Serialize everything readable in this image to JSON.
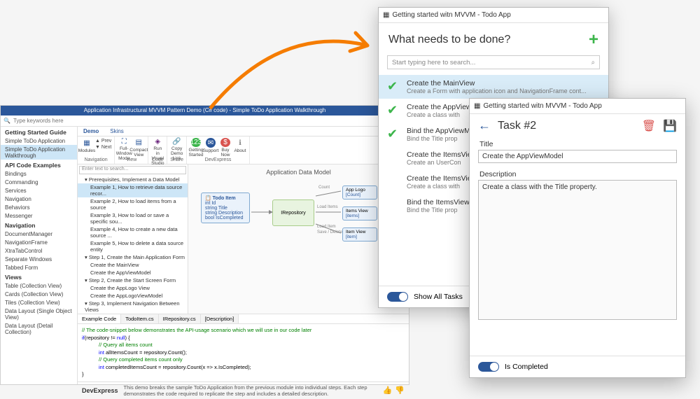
{
  "ide": {
    "title": "Application Infrastructural MVVM Pattern Demo (C# code) - Simple ToDo Application Walkthrough",
    "search_placeholder": "Type keywords here",
    "ribbon_tabs": {
      "demo": "Demo",
      "skins": "Skins"
    },
    "ribbon": {
      "modules": "Modules",
      "prev": "Prev",
      "next": "Next",
      "navigation": "Navigation",
      "fullwindow": "Full-Window Mode",
      "compact": "Compact View",
      "view": "View",
      "runvs": "Run in Visual Studio",
      "code": "Code",
      "copy": "Copy Demo Link",
      "share": "Share",
      "getting": "Getting Started",
      "support": "Support",
      "buy": "Buy Now",
      "about": "About",
      "dx": "DevExpress"
    },
    "sidebar": {
      "h1": "Getting Started Guide",
      "items1": [
        "Simple ToDo Application",
        "Simple ToDo Application Walkthrough"
      ],
      "h2": "API Code Examples",
      "items2": [
        "Bindings",
        "Commanding",
        "Services",
        "Navigation",
        "Behaviors",
        "Messenger"
      ],
      "h3": "Navigation",
      "items3": [
        "DocumentManager",
        "NavigationFrame",
        "XtraTabControl",
        "Separate Windows",
        "Tabbed Form"
      ],
      "h4": "Views",
      "items4": [
        "Table (Collection View)",
        "Cards (Collection View)",
        "Tiles (Collection View)",
        "Data Layout (Single Object View)",
        "Data Layout (Detail Collection)"
      ]
    },
    "tree": {
      "search": "Enter text to search...",
      "g1": "Prerequisites, Implement a Data Model",
      "e1": "Example 1, How to retrieve data source recor...",
      "e2": "Example 2, How to load items from a source",
      "e3": "Example 3, How to load or save a specific sou...",
      "e4": "Example 4, How to create a new data source ...",
      "e5": "Example 5, How to delete a data source entity",
      "g2": "Step 1, Create the Main Application Form",
      "s2a": "Create the MainView",
      "s2b": "Create the AppViewModel",
      "g3": "Step 2, Create the Start Screen Form",
      "s3a": "Create the AppLogo View",
      "s3b": "Create the AppLogoViewModel",
      "g4": "Step 3, Implement Navigation Between Views"
    },
    "diagram": {
      "title": "Application Data Model",
      "todo": "Todo Item",
      "todo_id": "int Id",
      "todo_title": "string Title",
      "todo_desc": "string Description",
      "todo_done": "bool IsCompleted",
      "repo": "IRepository",
      "applogo": "App Logo",
      "applogo_sub": "[Count]",
      "items": "Items View",
      "items_sub": "[items]",
      "item": "Item View",
      "item_sub": "[item]",
      "edge_count": "Count",
      "edge_load": "Load Items",
      "edge_loaditem": "Load Item",
      "edge_save": "Save / Delete"
    },
    "codetabs": [
      "Example Code",
      "TodoItem.cs",
      "IRepository.cs",
      "[Description]"
    ],
    "code": {
      "l1": "// The code-snippet below demonstrates the API-usage scenario which we will use in our code later",
      "l2a": "if",
      "l2b": "(repository != ",
      "l2c": "null",
      "l2d": ") {",
      "l3": "// Query all items count",
      "l4a": "int",
      "l4b": " allItemsCount = repository.Count();",
      "l5": "// Query completed items count only",
      "l6a": "int",
      "l6b": " completedItemsCount = repository.Count(x => x.IsCompleted);",
      "l7": "}"
    },
    "footer": {
      "logo": "DevExpress",
      "text": "This demo breaks the sample ToDo Application from the previous module into individual steps. Each step demonstrates the code required to replicate the step and includes a detailed description."
    }
  },
  "todo1": {
    "wintitle": "Getting started witn MVVM - Todo App",
    "heading": "What needs to be done?",
    "search": "Start typing here to search...",
    "tasks": [
      {
        "t": "Create the MainView",
        "d": "Create a Form with application icon and NavigationFrame cont...",
        "done": true
      },
      {
        "t": "Create the AppView",
        "d": "Create a class with",
        "done": true
      },
      {
        "t": "Bind the AppViewM",
        "d": "Bind the Title prop",
        "done": true
      },
      {
        "t": "Create the ItemsVie",
        "d": "Create an UserCon",
        "done": false
      },
      {
        "t": "Create the ItemsVie",
        "d": "Create a class with",
        "done": false
      },
      {
        "t": "Bind the ItemsView",
        "d": "Bind the Title prop",
        "done": false
      }
    ],
    "showall": "Show All Tasks"
  },
  "todo2": {
    "wintitle": "Getting started witn MVVM - Todo App",
    "heading": "Task #2",
    "title_label": "Title",
    "title_value": "Create the AppViewModel",
    "desc_label": "Description",
    "desc_value": "Create a class with the Title property.",
    "completed": "Is Completed"
  }
}
